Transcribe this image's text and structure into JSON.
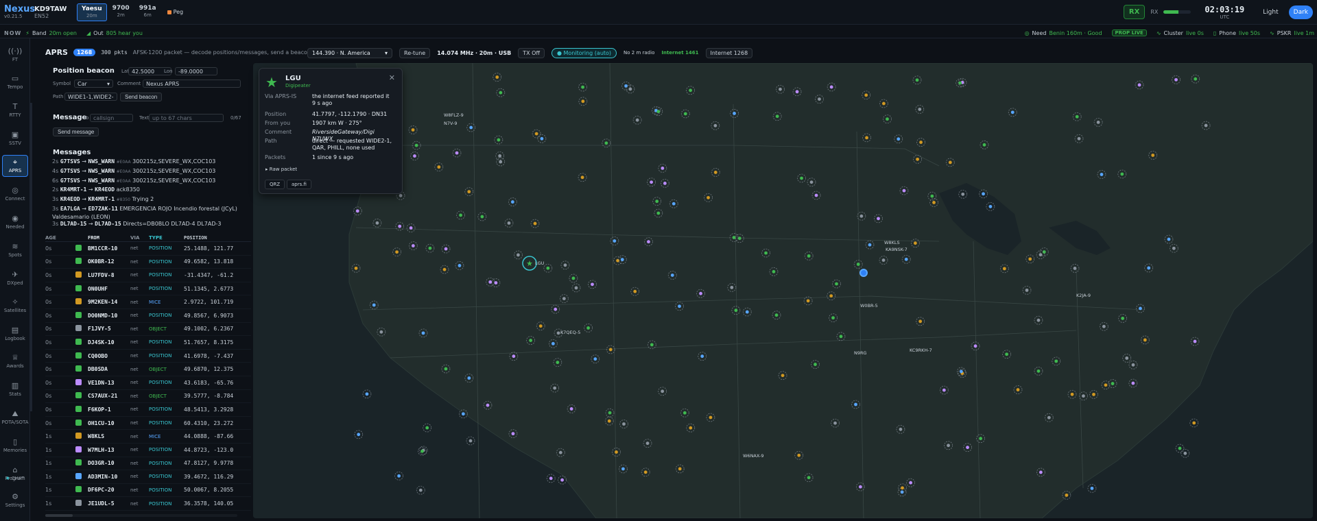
{
  "app": {
    "name": "Nexus",
    "version": "v0.21.5"
  },
  "station": {
    "callsign": "KD9TAW",
    "grid": "EN52"
  },
  "radios": [
    {
      "name": "Yaesu",
      "band": "20m",
      "active": true
    },
    {
      "name": "9700",
      "band": "2m",
      "active": false
    },
    {
      "name": "991a",
      "band": "6m",
      "active": false
    }
  ],
  "peg_label": "Peg",
  "rx": {
    "button": "RX",
    "label": "RX",
    "level": 0.55
  },
  "clock": {
    "time": "02:03:19",
    "zone": "UTC"
  },
  "theme": {
    "light": "Light",
    "dark": "Dark"
  },
  "nowbar": {
    "label": "NOW",
    "band_label": "Band",
    "band_value": "20m open",
    "out_label": "Out",
    "out_value": "805 hear you",
    "need_label": "Need",
    "need_value": "Benin 160m · Good",
    "prop_badge": "PROP LIVE",
    "cluster_label": "Cluster",
    "cluster_value": "live 0s",
    "phone_label": "Phone",
    "phone_value": "live 50s",
    "pskr_label": "PSKR",
    "pskr_value": "live 1m"
  },
  "nav": [
    {
      "label": "FT",
      "icon": "((·))",
      "name": "ft"
    },
    {
      "label": "Tempo",
      "icon": "▭",
      "name": "tempo"
    },
    {
      "label": "RTTY",
      "icon": "T",
      "name": "rtty"
    },
    {
      "label": "SSTV",
      "icon": "▣",
      "name": "sstv"
    },
    {
      "label": "APRS",
      "icon": "⌖",
      "name": "aprs",
      "active": true
    },
    {
      "label": "Connect",
      "icon": "◎",
      "name": "connect"
    },
    {
      "label": "Needed",
      "icon": "◉",
      "name": "needed"
    },
    {
      "label": "Spots",
      "icon": "≋",
      "name": "spots"
    },
    {
      "label": "DXped",
      "icon": "✈",
      "name": "dxped"
    },
    {
      "label": "Satellites",
      "icon": "✧",
      "name": "satellites"
    },
    {
      "label": "Logbook",
      "icon": "▤",
      "name": "logbook"
    },
    {
      "label": "Awards",
      "icon": "♕",
      "name": "awards"
    },
    {
      "label": "Stats",
      "icon": "▥",
      "name": "stats"
    },
    {
      "label": "POTA/SOTA",
      "icon": "⛰",
      "name": "pota-sota"
    },
    {
      "label": "Memories",
      "icon": "▯",
      "name": "memories"
    },
    {
      "label": "Program",
      "icon": "⌂",
      "name": "program"
    },
    {
      "label": "CHAT",
      "icon": "◉",
      "name": "chat"
    },
    {
      "label": "Settings",
      "icon": "⚙",
      "name": "settings"
    }
  ],
  "aprs": {
    "title": "APRS",
    "count": "1268",
    "pkts": "300 pkts",
    "subtitle": "AFSK-1200 packet — decode positions/messages, send a beacon"
  },
  "toolbar": {
    "freq_select": "144.390 · N. America",
    "retune": "Re-tune",
    "freq_text": "14.074 MHz · 20m · USB",
    "tx": "TX Off",
    "monitoring": "● Monitoring (auto)",
    "no2m": "No 2 m radio",
    "inet_live": "Internet 1461",
    "inet2": "Internet 1268"
  },
  "beacon": {
    "heading": "Position beacon",
    "lat_label": "Lat",
    "lat": "42.5000",
    "lon_label": "Lon",
    "lon": "-89.0000",
    "symbol_label": "Symbol",
    "symbol": "Car",
    "comment_label": "Comment",
    "comment": "Nexus APRS",
    "path_label": "Path",
    "path": "WIDE1-1,WIDE2-1",
    "send": "Send beacon"
  },
  "message": {
    "heading": "Message",
    "to_label": "To",
    "to_placeholder": "callsign",
    "text_label": "Text",
    "text_placeholder": "up to 67 chars",
    "counter": "0/67",
    "send": "Send message"
  },
  "messages": {
    "heading": "Messages",
    "items": [
      {
        "age": "2s",
        "from": "G7TSVS",
        "to": "NWS_WARN",
        "tag": "#E0AA",
        "text": "300215z,SEVERE_WX,COC103"
      },
      {
        "age": "4s",
        "from": "G7TSVS",
        "to": "NWS_WARN",
        "tag": "#E0AA",
        "text": "300215z,SEVERE_WX,COC103"
      },
      {
        "age": "6s",
        "from": "G7TSVS",
        "to": "NWS_WARN",
        "tag": "#E0AA",
        "text": "300215z,SEVERE_WX,COC103"
      },
      {
        "age": "2s",
        "from": "KR4MRT-1",
        "to": "KR4EOD",
        "tag": "",
        "text": "ack8350"
      },
      {
        "age": "3s",
        "from": "KR4EOD",
        "to": "KR4MRT-1",
        "tag": "#8350",
        "text": "Trying 2"
      },
      {
        "age": "3s",
        "from": "EA7LGA",
        "to": "ED7ZAK-11",
        "tag": "",
        "text": "EMERGENCIA ROJO Incendio forestal (JCyL) Valdesamario (LEON)"
      },
      {
        "age": "3s",
        "from": "DL7AD-15",
        "to": "DL7AD-15",
        "tag": "",
        "text": "Directs=DB0BLO DL7AD-4 DL7AD-3"
      }
    ]
  },
  "table": {
    "headers": {
      "age": "AGE",
      "from": "FROM",
      "via": "VIA",
      "type": "TYPE",
      "pos": "POSITION"
    },
    "rows": [
      {
        "age": "0s",
        "from": "BM1CCR-10",
        "via": "net",
        "type": "POSITION",
        "pos": "25.1488, 121.77",
        "color": "#3fb950"
      },
      {
        "age": "0s",
        "from": "OK0BR-12",
        "via": "net",
        "type": "POSITION",
        "pos": "49.6582, 13.818",
        "color": "#3fb950"
      },
      {
        "age": "0s",
        "from": "LU7FDV-8",
        "via": "net",
        "type": "POSITION",
        "pos": "-31.4347, -61.2",
        "color": "#d29922"
      },
      {
        "age": "0s",
        "from": "ON0UHF",
        "via": "net",
        "type": "POSITION",
        "pos": "51.1345, 2.6773",
        "color": "#3fb950"
      },
      {
        "age": "0s",
        "from": "9M2KEN-14",
        "via": "net",
        "type": "MICE",
        "pos": "2.9722, 101.719",
        "color": "#d29922"
      },
      {
        "age": "0s",
        "from": "DO0NMD-10",
        "via": "net",
        "type": "POSITION",
        "pos": "49.8567, 6.9073",
        "color": "#3fb950"
      },
      {
        "age": "0s",
        "from": "F1JVY-5",
        "via": "net",
        "type": "OBJECT",
        "pos": "49.1002, 6.2367",
        "color": "#8b949e"
      },
      {
        "age": "0s",
        "from": "DJ4SK-10",
        "via": "net",
        "type": "POSITION",
        "pos": "51.7657, 8.3175",
        "color": "#3fb950"
      },
      {
        "age": "0s",
        "from": "CQ0OBO",
        "via": "net",
        "type": "POSITION",
        "pos": "41.6978, -7.437",
        "color": "#3fb950"
      },
      {
        "age": "0s",
        "from": "DB0SDA",
        "via": "net",
        "type": "OBJECT",
        "pos": "49.6870, 12.375",
        "color": "#3fb950"
      },
      {
        "age": "0s",
        "from": "VE1DN-13",
        "via": "net",
        "type": "POSITION",
        "pos": "43.6183, -65.76",
        "color": "#bc8cff"
      },
      {
        "age": "0s",
        "from": "CS7AUX-21",
        "via": "net",
        "type": "OBJECT",
        "pos": "39.5777, -8.784",
        "color": "#3fb950"
      },
      {
        "age": "0s",
        "from": "F6KOP-1",
        "via": "net",
        "type": "POSITION",
        "pos": "48.5413, 3.2928",
        "color": "#3fb950"
      },
      {
        "age": "0s",
        "from": "OH1CU-10",
        "via": "net",
        "type": "POSITION",
        "pos": "60.4310, 23.272",
        "color": "#3fb950"
      },
      {
        "age": "1s",
        "from": "W8KLS",
        "via": "net",
        "type": "MICE",
        "pos": "44.0888, -87.66",
        "color": "#d29922"
      },
      {
        "age": "1s",
        "from": "W7MLH-13",
        "via": "net",
        "type": "POSITION",
        "pos": "44.8723, -123.0",
        "color": "#bc8cff"
      },
      {
        "age": "1s",
        "from": "DO3GR-10",
        "via": "net",
        "type": "POSITION",
        "pos": "47.8127, 9.9778",
        "color": "#3fb950"
      },
      {
        "age": "1s",
        "from": "AD3MIN-10",
        "via": "net",
        "type": "POSITION",
        "pos": "39.4672, 116.29",
        "color": "#58a6ff"
      },
      {
        "age": "1s",
        "from": "DF6PC-20",
        "via": "net",
        "type": "POSITION",
        "pos": "50.0067, 8.2055",
        "color": "#3fb950"
      },
      {
        "age": "1s",
        "from": "JE1UDL-5",
        "via": "net",
        "type": "POSITION",
        "pos": "36.3578, 140.05",
        "color": "#8b949e"
      }
    ]
  },
  "popup": {
    "title": "LGU",
    "subtitle": "Digipeater",
    "via_label": "Via APRS-IS",
    "via": "the internet feed reported it 9 s ago",
    "pos_label": "Position",
    "pos": "41.7797, -112.1790 · DN31",
    "from_label": "From you",
    "from": "1907 km W · 275°",
    "comment_label": "Comment",
    "comment": "RiversideGateway/Digi N7UWX",
    "path_label": "Path",
    "path": "direct — requested WIDE2-1, QAR, PHILL, none used",
    "packets_label": "Packets",
    "packets": "1 since 9 s ago",
    "raw": "▸ Raw packet",
    "qrz": "QRZ",
    "aprsfi": "aprs.fi"
  },
  "map_labels": {
    "lgu": "LGU",
    "w8kls": "W8KLS",
    "ka9nsk": "KA9NSK-7",
    "k2ja": "K2JA-9",
    "wb0r": "W0BR-5",
    "kc9rkh": "KC9RKH-7",
    "n9rg": "N9RG",
    "k7qeq": "K7QEQ-5",
    "w6nax": "W6NAX-9",
    "w8flz": "W8FLZ-9",
    "n7v": "N7V-9"
  },
  "colors": {
    "accent": "#2f81f7",
    "green": "#3fb950",
    "cyan": "#39c5cf",
    "purple": "#bc8cff",
    "amber": "#d29922"
  }
}
